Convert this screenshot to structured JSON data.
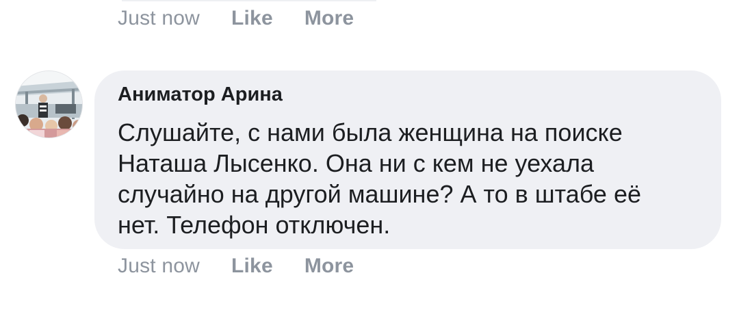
{
  "previous_comment": {
    "timestamp": "Just now",
    "like_label": "Like",
    "more_label": "More"
  },
  "comment": {
    "avatar_icon": "user-avatar-photo",
    "author": "Аниматор Арина",
    "text": "Слушайте, с нами была женщина на поиске Наташа Лысенко. Она ни с кем не уехала случайно на другой машине? А то в штабе её нет. Телефон отключен.",
    "timestamp": "Just now",
    "like_label": "Like",
    "more_label": "More"
  },
  "colors": {
    "bubble_bg": "#eff0f4",
    "meta_text": "#8d949e",
    "body_text": "#1c1e21"
  }
}
